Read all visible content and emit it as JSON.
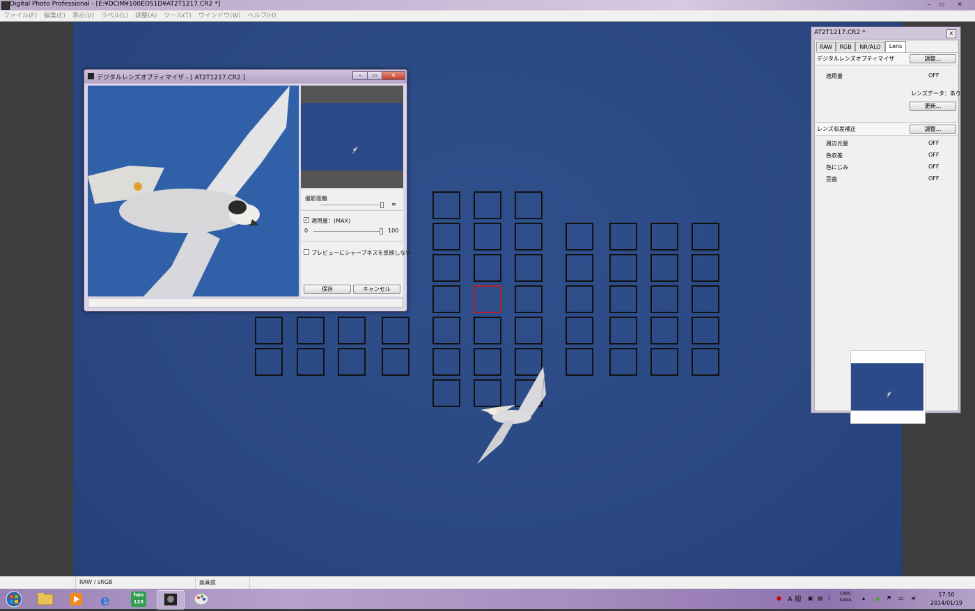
{
  "window": {
    "title": "Digital Photo Professional - [E:¥DCIM¥100EOS1D¥AT2T1217.CR2 *]",
    "min": "–",
    "max": "▭",
    "close": "✕"
  },
  "menu": [
    "ファイル(F)",
    "編集(E)",
    "表示(V)",
    "ラベル(L)",
    "調整(A)",
    "ツール(T)",
    "ウインドウ(W)",
    "ヘルプ(H)"
  ],
  "dialog": {
    "title": "デジタルレンズオプティマイザ - [ AT2T1217.CR2 ]",
    "distance_label": "撮影距離",
    "distance_infinity": "∞",
    "apply_label": "適用量：(MAX)",
    "apply_checked": "✓",
    "apply_min": "0",
    "apply_max": "100",
    "apply_value": 100,
    "sharpness_label": "プレビューにシャープネスを反映しない",
    "save_button": "保存",
    "cancel_button": "キャンセル"
  },
  "palette": {
    "title": "AT2T1217.CR2 *",
    "close": "x",
    "tabs": [
      "RAW",
      "RGB",
      "NR/ALO",
      "Lens"
    ],
    "active_tab": "Lens",
    "dlo_section": "デジタルレンズオプティマイザ",
    "adjust_button": "調整...",
    "apply_amount_label": "適用量",
    "apply_amount_value": "OFF",
    "lens_data": "レンズデータ：あり",
    "update_button": "更新...",
    "aberration_section": "レンズ収差補正",
    "aberration_adjust": "調整...",
    "aberration_rows": [
      {
        "label": "周辺光量",
        "value": "OFF"
      },
      {
        "label": "色収差",
        "value": "OFF"
      },
      {
        "label": "色にじみ",
        "value": "OFF"
      },
      {
        "label": "歪曲",
        "value": "OFF"
      }
    ]
  },
  "statusbar": {
    "color": "RAW / sRGB",
    "quality": "高画質"
  },
  "taskbar": {
    "apps": [
      "start-orb",
      "explorer",
      "media-player",
      "internet-explorer",
      "hao123",
      "digital-photo-professional",
      "paint"
    ],
    "hao_label": "hao 123",
    "tray_a": "A 般",
    "caps": "CAPS",
    "kana": "KANA",
    "time": "17:50",
    "date": "2014/01/19"
  },
  "colors": {
    "sky": "#2c4a88",
    "selected_af": "#b3202a",
    "chrome": "#d0c6dc"
  }
}
